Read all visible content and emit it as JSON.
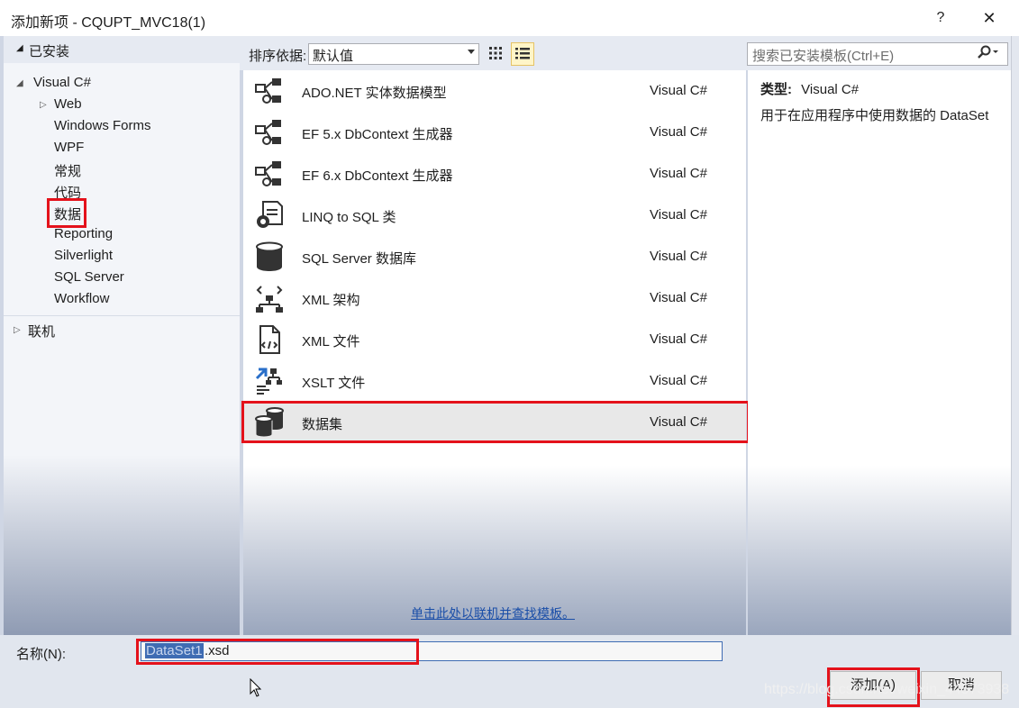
{
  "window": {
    "title": "添加新项 - CQUPT_MVC18(1)",
    "help": "?",
    "close": "✕"
  },
  "left": {
    "installed": "已安装",
    "root": "Visual C#",
    "children": [
      "Web",
      "Windows Forms",
      "WPF",
      "常规",
      "代码",
      "数据",
      "Reporting",
      "Silverlight",
      "SQL Server",
      "Workflow"
    ],
    "selected": "数据",
    "online": "联机"
  },
  "toolbar": {
    "sort_label": "排序依据:",
    "sort_value": "默认值"
  },
  "search": {
    "placeholder": "搜索已安装模板(Ctrl+E)"
  },
  "templates": [
    {
      "name": "ADO.NET 实体数据模型",
      "lang": "Visual C#",
      "icon": "entity-model-icon"
    },
    {
      "name": "EF 5.x DbContext 生成器",
      "lang": "Visual C#",
      "icon": "entity-model-icon"
    },
    {
      "name": "EF 6.x DbContext 生成器",
      "lang": "Visual C#",
      "icon": "entity-model-icon"
    },
    {
      "name": "LINQ to SQL 类",
      "lang": "Visual C#",
      "icon": "linq-icon"
    },
    {
      "name": "SQL Server 数据库",
      "lang": "Visual C#",
      "icon": "database-icon"
    },
    {
      "name": "XML 架构",
      "lang": "Visual C#",
      "icon": "xml-schema-icon"
    },
    {
      "name": "XML 文件",
      "lang": "Visual C#",
      "icon": "xml-file-icon"
    },
    {
      "name": "XSLT 文件",
      "lang": "Visual C#",
      "icon": "xslt-file-icon"
    },
    {
      "name": "数据集",
      "lang": "Visual C#",
      "icon": "dataset-icon",
      "selected": true
    }
  ],
  "info": {
    "type_label": "类型:",
    "type_value": "Visual C#",
    "description": "用于在应用程序中使用数据的 DataSet"
  },
  "online_link": "单击此处以联机并查找模板。",
  "name_field": {
    "label": "名称(N):",
    "selected_part": "DataSet1",
    "rest": ".xsd"
  },
  "buttons": {
    "add": "添加(A)",
    "cancel": "取消"
  },
  "watermark": "https://blog.csdn.net/weixin_44573938",
  "colors": {
    "highlight": "#e4121b",
    "selection_blue": "#3f6cb3"
  }
}
